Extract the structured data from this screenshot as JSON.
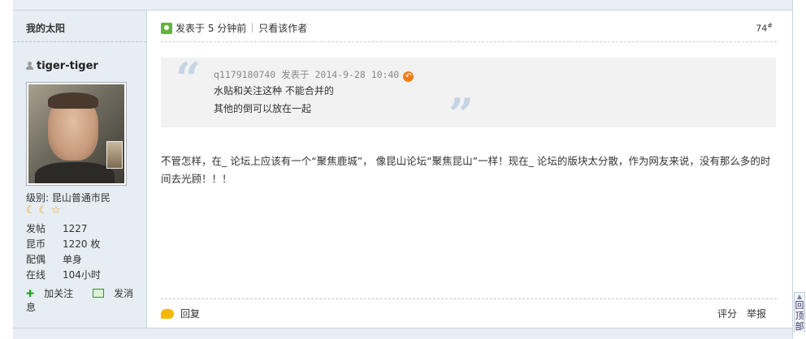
{
  "sidebar": {
    "title": "我的太阳",
    "username": "tiger-tiger",
    "level_label": "级别: 昆山普通市民",
    "badges": [
      "☾",
      "☾",
      "☆"
    ],
    "stats": [
      {
        "key": "发帖",
        "value": "1227"
      },
      {
        "key": "昆币",
        "value": "1220 枚"
      },
      {
        "key": "配偶",
        "value": "单身"
      },
      {
        "key": "在线",
        "value": "104小时"
      }
    ],
    "follow_label": "加关注",
    "message_label": "发消息"
  },
  "post": {
    "posted_time": "发表于 5 分钟前",
    "only_author": "只看该作者",
    "floor": "74",
    "floor_mark": "#",
    "quote": {
      "meta": "q1179180740 发表于 2014-9-28 10:40",
      "line1": "水贴和关注这种  不能合并的",
      "line2": "其他的倒可以放在一起"
    },
    "body": "不管怎样，在_  论坛上应该有一个“聚焦鹿城”， 像昆山论坛“聚焦昆山”一样！现在_  论坛的版块太分散，作为网友来说，没有那么多的时间去光顾！！！",
    "reply_label": "回复",
    "rate_label": "评分",
    "report_label": "举报"
  },
  "back_to_top": "回顶部",
  "colors": {
    "sidebar_bg": "#e6edf3",
    "quote_bg": "#f2f2f2",
    "quote_mark": "#c4d4e4",
    "badge": "#f2a10a"
  },
  "icons": [
    "user-icon",
    "avatar",
    "moon-badge-icon",
    "star-badge-icon",
    "plus-icon",
    "mail-icon",
    "post-time-icon",
    "quote-open-icon",
    "quote-close-icon",
    "back-arrow-icon",
    "reply-icon",
    "back-to-top-icon"
  ]
}
